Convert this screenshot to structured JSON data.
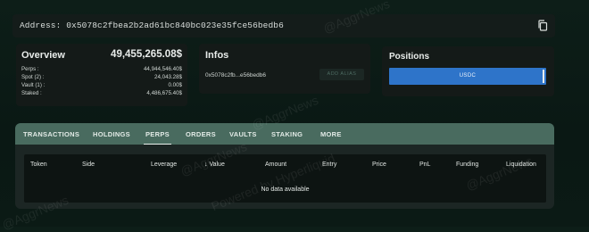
{
  "address": {
    "label": "Address:",
    "value": "0x5078c2fbea2b2ad61bc840bc023e35fce56bedb6"
  },
  "overview": {
    "title": "Overview",
    "total": "49,455,265.08$",
    "rows": [
      {
        "label": "Perps :",
        "value": "44,944,546.40$"
      },
      {
        "label": "Spot (2) :",
        "value": "24,043.28$"
      },
      {
        "label": "Vault (1) :",
        "value": "0.00$"
      },
      {
        "label": "Staked :",
        "value": "4,486,675.40$"
      }
    ]
  },
  "infos": {
    "title": "Infos",
    "short_address": "0x5078c2fb...e56bedb6",
    "alias_button": "ADD ALIAS"
  },
  "positions": {
    "title": "Positions",
    "bar_label": "USDC",
    "bar_color": "#2e74c9"
  },
  "tabs": [
    {
      "label": "TRANSACTIONS",
      "active": false
    },
    {
      "label": "HOLDINGS",
      "active": false
    },
    {
      "label": "PERPS",
      "active": true
    },
    {
      "label": "ORDERS",
      "active": false
    },
    {
      "label": "VAULTS",
      "active": false
    },
    {
      "label": "STAKING",
      "active": false
    },
    {
      "label": "MORE",
      "active": false
    }
  ],
  "table": {
    "columns": [
      {
        "label": "Token"
      },
      {
        "label": "Side"
      },
      {
        "label": "Leverage"
      },
      {
        "label": "Value",
        "sort_icon": "arrow-down-icon"
      },
      {
        "label": "Amount"
      },
      {
        "label": "Entry"
      },
      {
        "label": "Price"
      },
      {
        "label": "PnL"
      },
      {
        "label": "Funding"
      },
      {
        "label": "Liquidation"
      }
    ],
    "empty_message": "No data available"
  },
  "watermarks": [
    "@AggrNews",
    "@AggrNews",
    "@AggrNews",
    "@AggrNews",
    "@AggrNews",
    "Powered by Hyperliquid"
  ],
  "colors": {
    "background": "#0b1a15",
    "tab_bar": "#496b5f",
    "accent": "#2e74c9"
  }
}
